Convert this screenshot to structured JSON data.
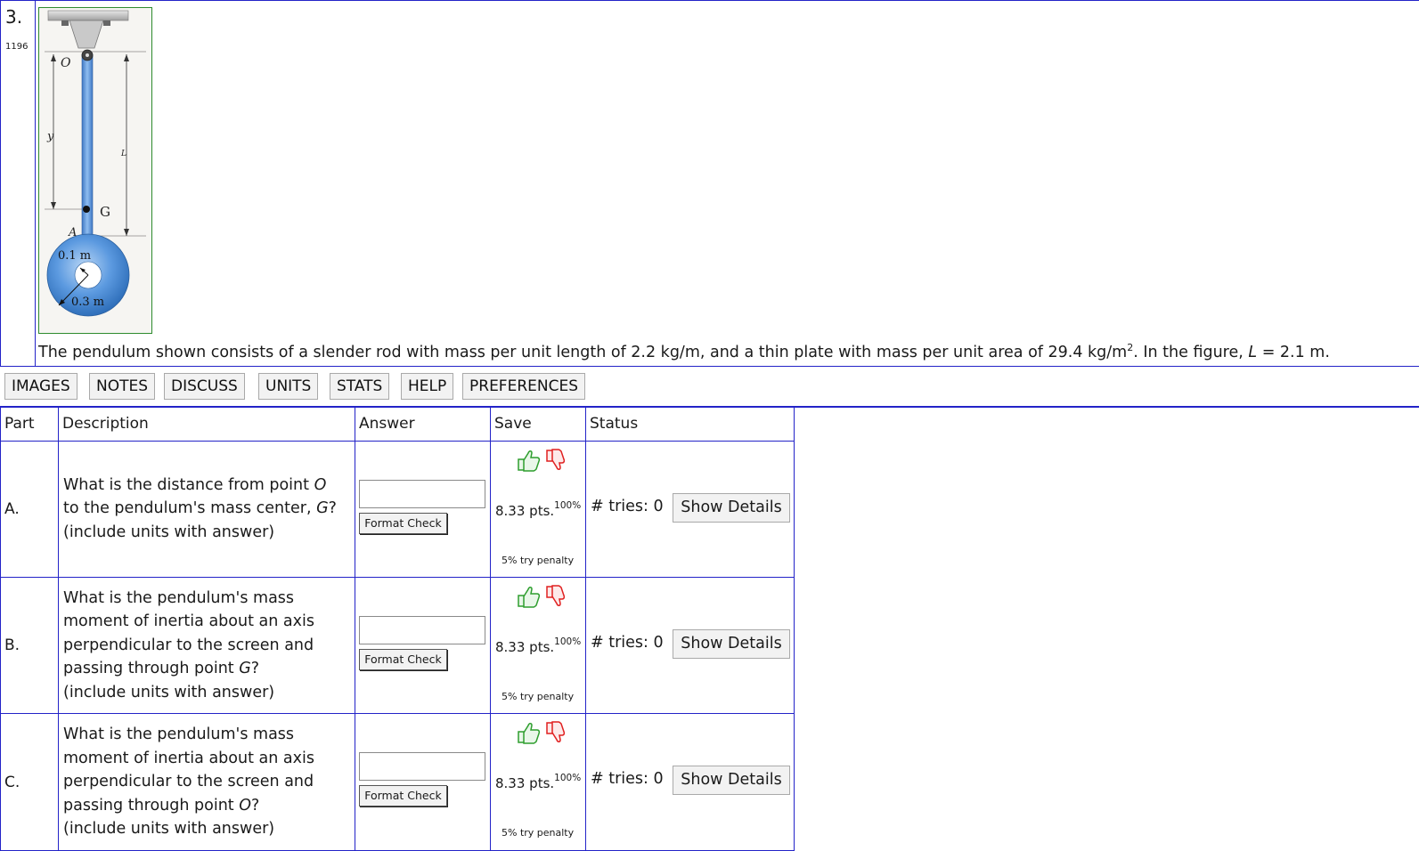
{
  "problem": {
    "number": "3.",
    "id": "1196",
    "text_before": "The pendulum shown consists of a slender rod with mass per unit length of 2.2 kg/m, and a thin plate with mass per unit area of 29.4 kg/m",
    "text_sup": "2",
    "text_mid": ". In the figure, ",
    "text_var": "L",
    "text_after": " = 2.1 m.",
    "figure": {
      "label_O": "O",
      "label_y": "y",
      "label_L": "L",
      "label_G": "G",
      "label_A": "A",
      "label_inner": "0.1 m",
      "label_outer": "0.3 m"
    }
  },
  "toolbar": {
    "buttons": [
      "IMAGES",
      "NOTES",
      "DISCUSS",
      "UNITS",
      "STATS",
      "HELP",
      "PREFERENCES"
    ]
  },
  "table": {
    "headers": {
      "part": "Part",
      "description": "Description",
      "answer": "Answer",
      "save": "Save",
      "status": "Status"
    },
    "rows": [
      {
        "part": "A.",
        "desc_lines": [
          {
            "pre": "What is the distance from point ",
            "var": "O",
            "post": ""
          },
          {
            "pre": "to the pendulum's mass center, ",
            "var": "G",
            "post": "?"
          },
          {
            "pre": "(include units with answer)",
            "var": "",
            "post": ""
          }
        ],
        "answer_value": "",
        "format_check": "Format Check",
        "pts": "8.33 pts.",
        "pct": "100%",
        "penalty": "5% try penalty",
        "tries": "# tries: 0",
        "details": "Show Details"
      },
      {
        "part": "B.",
        "desc_lines": [
          {
            "pre": "What is the pendulum's mass",
            "var": "",
            "post": ""
          },
          {
            "pre": "moment of inertia about an axis",
            "var": "",
            "post": ""
          },
          {
            "pre": "perpendicular to the screen and",
            "var": "",
            "post": ""
          },
          {
            "pre": "passing through point ",
            "var": "G",
            "post": "?"
          },
          {
            "pre": "(include units with answer)",
            "var": "",
            "post": ""
          }
        ],
        "answer_value": "",
        "format_check": "Format Check",
        "pts": "8.33 pts.",
        "pct": "100%",
        "penalty": "5% try penalty",
        "tries": "# tries: 0",
        "details": "Show Details"
      },
      {
        "part": "C.",
        "desc_lines": [
          {
            "pre": "What is the pendulum's mass",
            "var": "",
            "post": ""
          },
          {
            "pre": "moment of inertia about an axis",
            "var": "",
            "post": ""
          },
          {
            "pre": "perpendicular to the screen and",
            "var": "",
            "post": ""
          },
          {
            "pre": "passing through point ",
            "var": "O",
            "post": "?"
          },
          {
            "pre": "(include units with answer)",
            "var": "",
            "post": ""
          }
        ],
        "answer_value": "",
        "format_check": "Format Check",
        "pts": "8.33 pts.",
        "pct": "100%",
        "penalty": "5% try penalty",
        "tries": "# tries: 0",
        "details": "Show Details"
      }
    ]
  },
  "colors": {
    "border_blue": "#2323c8",
    "thumb_up": "#2e9e2e",
    "thumb_down": "#e02020",
    "figure_border": "#2d8b2d",
    "plate_blue": "#4f8fd6"
  }
}
